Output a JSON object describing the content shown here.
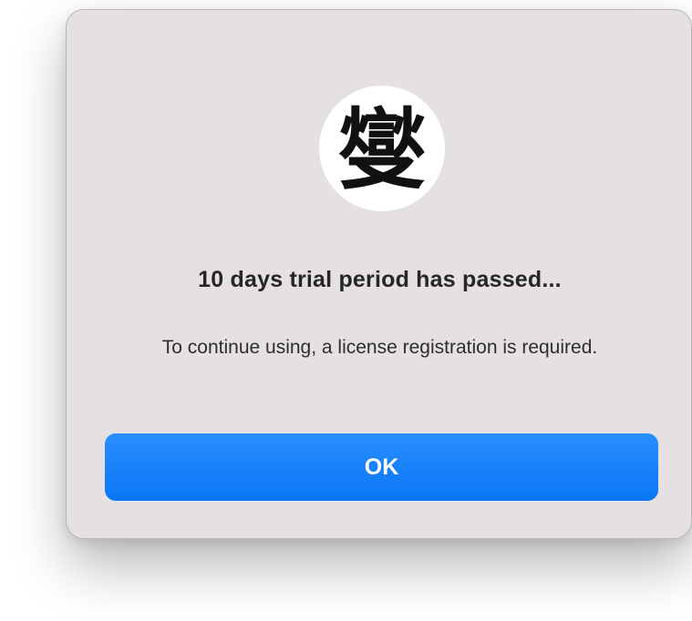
{
  "dialog": {
    "icon": {
      "name": "app-logo-icon",
      "glyph": "燮"
    },
    "title": "10 days trial period has passed...",
    "message": "To continue using, a license registration is required.",
    "ok_label": "OK"
  },
  "colors": {
    "dialog_background": "#e4e0e3",
    "button_accent": "#0a7af5",
    "button_text": "#ffffff"
  }
}
